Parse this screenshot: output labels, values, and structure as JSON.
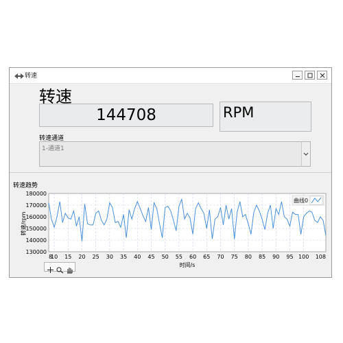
{
  "window": {
    "title": "转速"
  },
  "rpm": {
    "label": "转速",
    "value": "144708",
    "unit": "RPM"
  },
  "channel": {
    "label": "转速通道",
    "selected": "1-通道1"
  },
  "chart_section": {
    "title": "转速趋势"
  },
  "colors": {
    "window_bg": "#f0f0f0",
    "series": "#4a90d9",
    "grid": "#ccd3ea"
  },
  "icons": {
    "app": "double-arrow-icon",
    "minimize": "minimize-icon",
    "maximize": "maximize-icon",
    "close": "close-icon",
    "dropdown": "chevron-down-icon",
    "legend": "line-series-icon",
    "tools": [
      "crosshair-icon",
      "zoom-icon",
      "pan-icon"
    ]
  },
  "chart_data": {
    "type": "line",
    "title": "",
    "xlabel": "时间/s",
    "ylabel": "转速/rpm",
    "xlim": [
      8,
      108
    ],
    "ylim": [
      130000,
      180000
    ],
    "xticks": [
      8,
      10,
      15,
      20,
      25,
      30,
      35,
      40,
      45,
      50,
      55,
      60,
      65,
      70,
      75,
      80,
      85,
      90,
      95,
      100,
      108
    ],
    "xtick_labels": [
      "8",
      "10",
      "15",
      "20",
      "25",
      "30",
      "35",
      "40",
      "45",
      "50",
      "55",
      "60",
      "65",
      "70",
      "75",
      "80",
      "85",
      "90",
      "95",
      "100",
      "108"
    ],
    "yticks": [
      130000,
      140000,
      150000,
      160000,
      170000,
      180000
    ],
    "ytick_labels": [
      "130000",
      "140000",
      "150000",
      "160000",
      "170000",
      "180000"
    ],
    "grid": true,
    "legend_position": "top-right",
    "series": [
      {
        "name": "曲线0",
        "color": "#4a90d9",
        "x": [
          8,
          9,
          10,
          11,
          12,
          13,
          14,
          15,
          16,
          17,
          18,
          19,
          20,
          21,
          22,
          23,
          24,
          25,
          26,
          27,
          28,
          29,
          30,
          31,
          32,
          33,
          34,
          35,
          36,
          37,
          38,
          39,
          40,
          41,
          42,
          43,
          44,
          45,
          46,
          47,
          48,
          49,
          50,
          51,
          52,
          53,
          54,
          55,
          56,
          57,
          58,
          59,
          60,
          61,
          62,
          63,
          64,
          65,
          66,
          67,
          68,
          69,
          70,
          71,
          72,
          73,
          74,
          75,
          76,
          77,
          78,
          79,
          80,
          81,
          82,
          83,
          84,
          85,
          86,
          87,
          88,
          89,
          90,
          91,
          92,
          93,
          94,
          95,
          96,
          97,
          98,
          99,
          100,
          101,
          102,
          103,
          104,
          105,
          106,
          107,
          108
        ],
        "values": [
          172000,
          158000,
          151000,
          160000,
          173000,
          155000,
          163000,
          159000,
          158000,
          165000,
          152000,
          160000,
          139000,
          171000,
          154000,
          153000,
          153000,
          163000,
          165000,
          157000,
          153000,
          158000,
          172000,
          168000,
          155000,
          156000,
          151000,
          162000,
          142000,
          166000,
          158000,
          167000,
          173000,
          167000,
          161000,
          156000,
          168000,
          149000,
          172000,
          167000,
          154000,
          142000,
          168000,
          169000,
          165000,
          157000,
          148000,
          169000,
          175000,
          158000,
          163000,
          159000,
          145000,
          167000,
          172000,
          167000,
          163000,
          150000,
          166000,
          141000,
          158000,
          160000,
          168000,
          153000,
          170000,
          158000,
          167000,
          141000,
          164000,
          173000,
          160000,
          162000,
          154000,
          145000,
          164000,
          170000,
          165000,
          158000,
          149000,
          163000,
          170000,
          150000,
          167000,
          162000,
          173000,
          160000,
          158000,
          152000,
          164000,
          162000,
          162000,
          145000,
          160000,
          163000,
          165000,
          164000,
          157000,
          155000,
          160000,
          157000,
          144000
        ]
      }
    ]
  }
}
